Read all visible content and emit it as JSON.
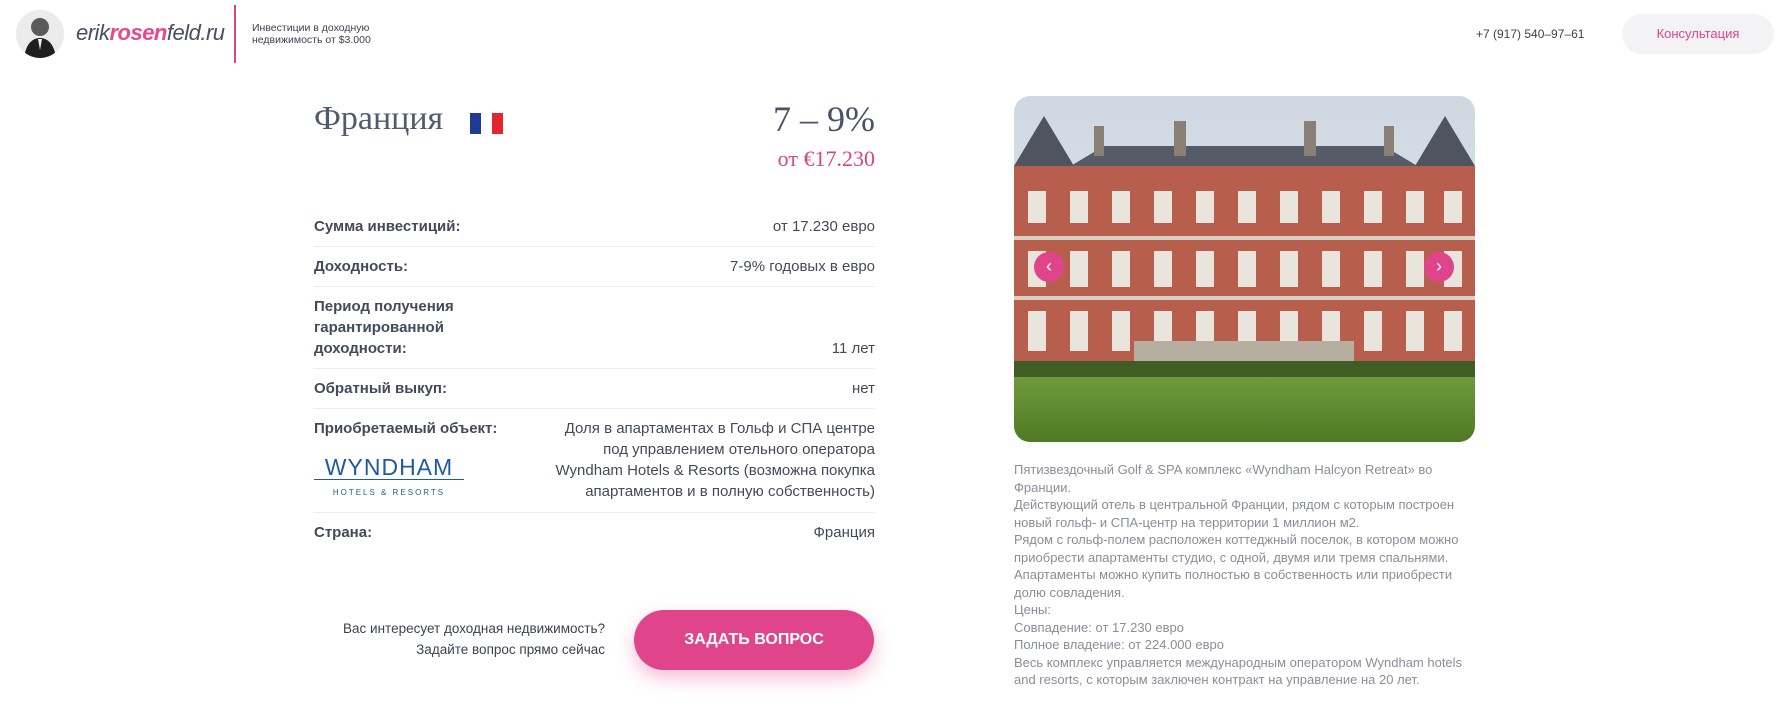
{
  "header": {
    "logo_prefix": "erik",
    "logo_accent": "rosen",
    "logo_suffix": "feld.ru",
    "tagline": "Инвестиции в доходную недвижимость от $3.000",
    "phone": "+7 (917) 540–97–61",
    "consult_label": "Консультация"
  },
  "offer": {
    "country": "Франция",
    "flag_colors": [
      "#1e3a93",
      "#ffffff",
      "#e3262e"
    ],
    "yield": "7 – 9%",
    "price": "от €17.230"
  },
  "details": [
    {
      "label": "Сумма инвестиций:",
      "value": "от 17.230 евро"
    },
    {
      "label": "Доходность:",
      "value": "7-9% годовых в евро"
    },
    {
      "label": "Период получения гарантированной доходности:",
      "value": "11 лет"
    },
    {
      "label": "Обратный выкуп:",
      "value": "нет"
    },
    {
      "label": "Приобретаемый объект:",
      "value": "Доля в апартаментах в Гольф и СПА центре под управлением отельного оператора Wyndham Hotels & Resorts (возможна покупка апартаментов и в полную собственность)"
    },
    {
      "label": "Страна:",
      "value": "Франция"
    }
  ],
  "wyndham_logo": {
    "line1": "WYNDHAM",
    "line2": "HOTELS & RESORTS"
  },
  "cta": {
    "line1": "Вас интересует доходная недвижимость?",
    "line2": "Задайте вопрос прямо сейчас",
    "button": "ЗАДАТЬ ВОПРОС"
  },
  "slider": {
    "prev_icon": "‹",
    "next_icon": "›"
  },
  "description": [
    "Пятизвездочный Golf & SPA комплекс «Wyndham Halcyon Retreat» во Франции.",
    "Действующий отель в центральной Франции, рядом с которым построен новый гольф- и СПА-центр на территории 1 миллион м2.",
    "Рядом с гольф-полем расположен коттеджный поселок, в котором можно приобрести апартаменты студио, с одной, двумя или тремя спальнями.",
    "Апартаменты можно купить полностью в собственность или приобрести долю совладения.",
    "Цены:",
    "Совпадение: от 17.230 евро",
    "Полное владение: от 224.000 евро",
    "Весь комплекс управляется международным оператором Wyndham hotels and resorts, с которым заключен контракт на управление на 20 лет."
  ]
}
